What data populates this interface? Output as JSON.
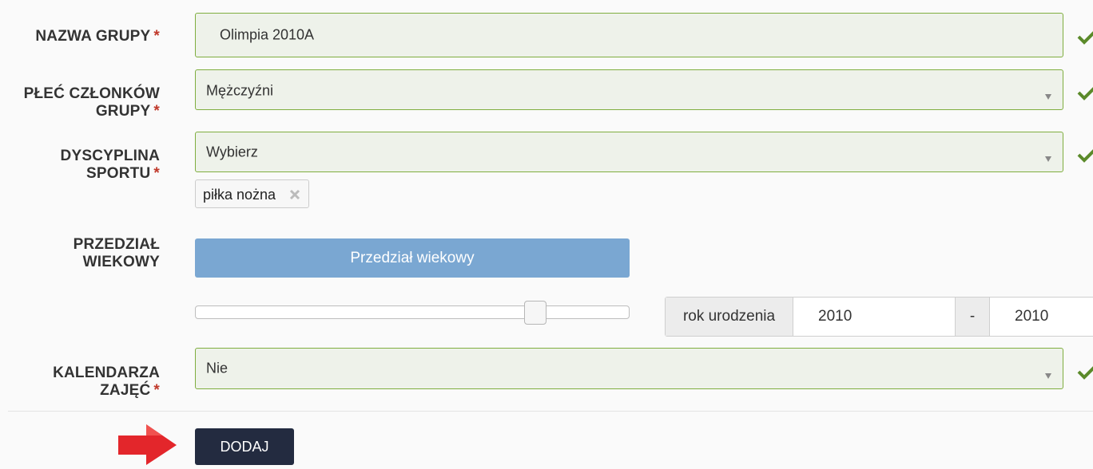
{
  "form": {
    "group_name": {
      "label": "NAZWA GRUPY",
      "required_mark": "*",
      "value": "Olimpia 2010A"
    },
    "gender": {
      "label": "PŁEĆ CZŁONKÓW GRUPY",
      "required_mark": "*",
      "value": "Mężczyźni"
    },
    "discipline": {
      "label": "DYSCYPLINA SPORTU",
      "required_mark": "*",
      "value": "Wybierz",
      "tags": [
        "piłka nożna"
      ]
    },
    "age_range": {
      "label": "PRZEDZIAŁ WIEKOWY",
      "button_label": "Przedział wiekowy",
      "slider_level": 0.8,
      "year_addon": "rok urodzenia",
      "year_from": "2010",
      "separator": "-",
      "year_to": "2010"
    },
    "calendar": {
      "label": "KALENDARZA ZAJĘĆ",
      "required_mark": "*",
      "value": "Nie"
    },
    "submit_label": "DODAJ"
  },
  "colors": {
    "valid": "#5b8a2a",
    "required": "#c0392b",
    "field_bg": "#eef2ea",
    "button_blue": "#7aa7d2",
    "submit_bg": "#232b40",
    "arrow": "#e3262b"
  },
  "icons": {
    "valid": "check-icon",
    "dropdown": "chevron-down-icon",
    "remove": "close-icon",
    "pointer": "arrow-right-icon"
  }
}
